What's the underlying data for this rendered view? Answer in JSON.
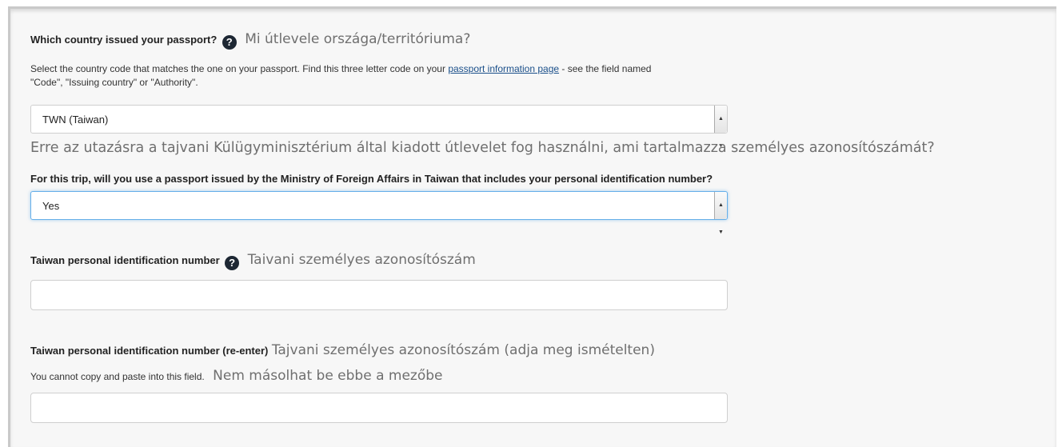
{
  "passport_country": {
    "label": "Which country issued your passport?",
    "label_hu": "Mi útlevele országa/territóriuma?",
    "help_before_link": "Select the country code that matches the one on your passport.  Find this three letter code on your ",
    "help_link": "passport information page",
    "help_after_link": " - see the field named",
    "help_line2": "\"Code\", \"Issuing country\" or \"Authority\".",
    "selected_value": "TWN (Taiwan)"
  },
  "taiwan_passport": {
    "question_hu": "Erre az utazásra a tajvani Külügyminisztérium által kiadott útlevelet fog használni, ami tartalmazza személyes azonosítószámát?",
    "question": "For this trip, will you use a passport issued by the Ministry of Foreign Affairs in Taiwan that includes your personal identification number?",
    "selected_value": "Yes"
  },
  "pin": {
    "label": "Taiwan personal identification number",
    "label_hu": "Taivani személyes azonosítószám",
    "value": ""
  },
  "pin_reenter": {
    "label": "Taiwan personal identification number (re-enter)",
    "label_hu": "Tajvani személyes azonosítószám (adja meg ismételten)",
    "help": "You cannot copy and paste into this field.",
    "help_hu": "Nem másolhat be ebbe a mezőbe",
    "value": ""
  },
  "icons": {
    "help": "question-circle-icon",
    "dropdown": "triangle-up-down-icon"
  },
  "colors": {
    "panel_bg": "#f7f7f7",
    "link": "#1a4f8a",
    "focus": "#66afe9",
    "help_icon": "#1d2733"
  }
}
